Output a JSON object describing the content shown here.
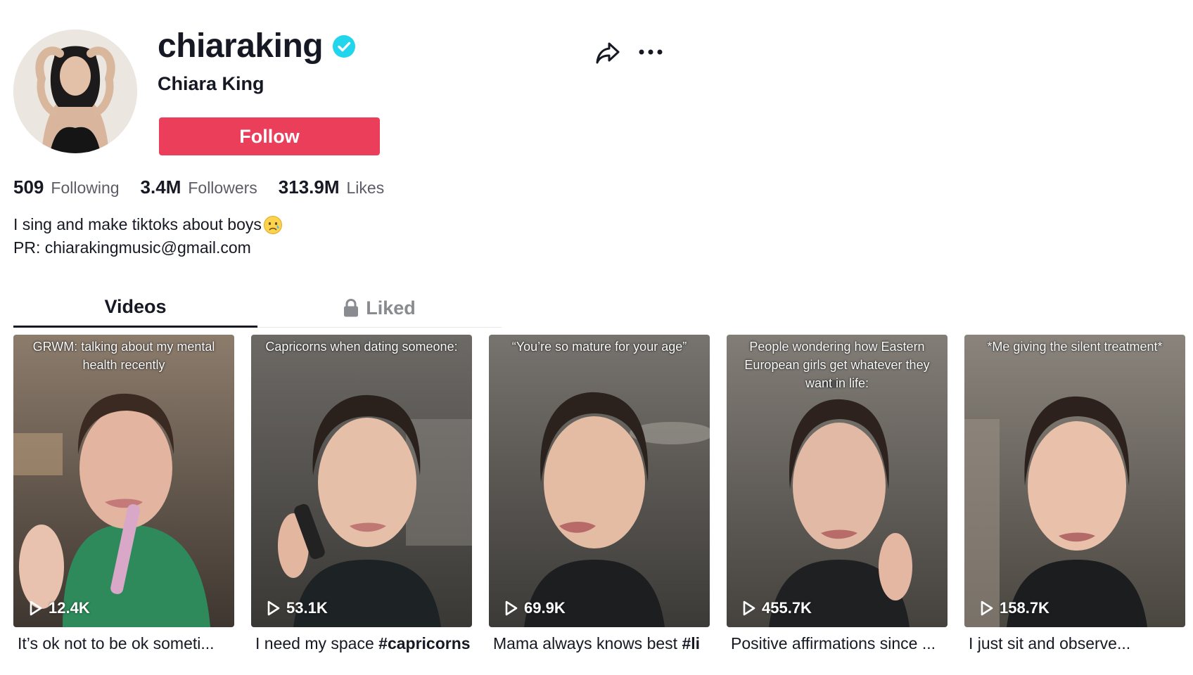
{
  "profile": {
    "username": "chiaraking",
    "display_name": "Chiara King",
    "follow_label": "Follow",
    "verified": true,
    "stats": [
      {
        "value": "509",
        "label": "Following"
      },
      {
        "value": "3.4M",
        "label": "Followers"
      },
      {
        "value": "313.9M",
        "label": "Likes"
      }
    ],
    "bio": {
      "line1": "I sing and make tiktoks about boys",
      "emoji": "crying-face-emoji",
      "line2": "PR: chiarakingmusic@gmail.com"
    }
  },
  "actions": {
    "share_icon": "share-arrow-icon",
    "more_icon": "more-dots-icon"
  },
  "tabs": {
    "videos": "Videos",
    "liked": "Liked",
    "liked_icon": "lock-icon"
  },
  "colors": {
    "accent": "#ea3e5a",
    "verified": "#20d5ec",
    "text": "#161823",
    "muted": "#5c5c66"
  },
  "videos": [
    {
      "overlay": "GRWM: talking about my mental health recently",
      "views": "12.4K",
      "caption": "It’s ok not to be ok someti..."
    },
    {
      "overlay": "Capricorns when dating someone:",
      "views": "53.1K",
      "caption_text": "I need my space ",
      "caption_tag": "#capricorns"
    },
    {
      "overlay": "“You’re so mature for your age”",
      "views": "69.9K",
      "caption_text": "Mama always knows best ",
      "caption_tag": "#li"
    },
    {
      "overlay": "People wondering how Eastern European girls get whatever they want in life:",
      "views": "455.7K",
      "caption": "Positive affirmations since ..."
    },
    {
      "overlay": "*Me giving the silent treatment*",
      "views": "158.7K",
      "caption": "I just sit and observe..."
    }
  ]
}
